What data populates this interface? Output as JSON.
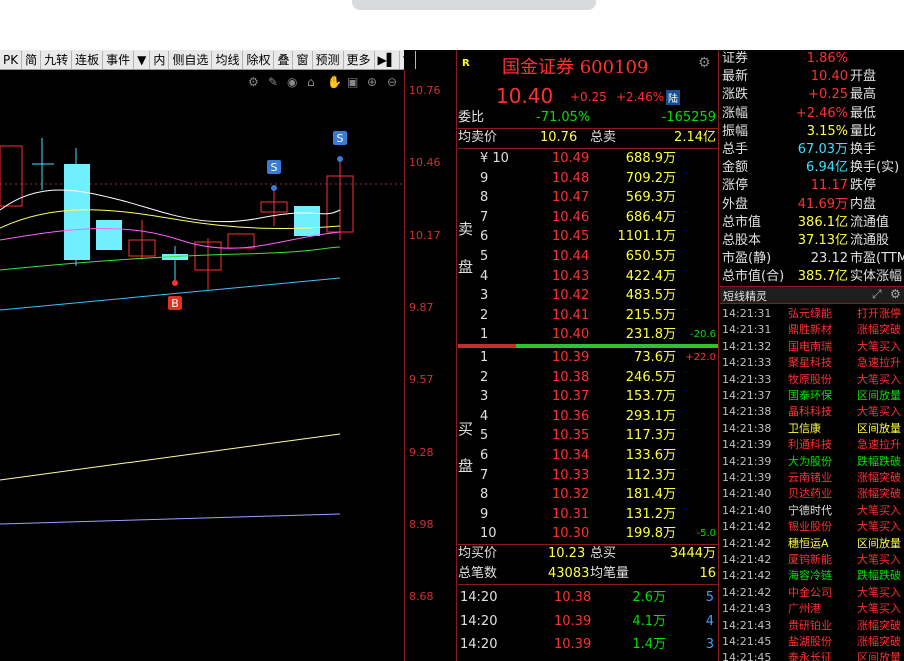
{
  "toolbar": {
    "items": [
      "PK",
      "简",
      "九转",
      "连板",
      "事件",
      "▼",
      "内",
      "侧自选",
      "均线",
      "除权",
      "叠",
      "窗",
      "预测",
      "更多",
      "▶▌",
      "▼"
    ]
  },
  "price_axis": [
    "10.76",
    "10.46",
    "10.17",
    "9.87",
    "9.57",
    "9.28",
    "8.98",
    "8.68"
  ],
  "chart_marks": {
    "s1": "S",
    "s2": "S",
    "b1": "B"
  },
  "quote": {
    "name": "国金证券 600109",
    "badge": "R",
    "price": "10.40",
    "change": "+0.25",
    "change_pct": "+2.46%",
    "board": "陆"
  },
  "summary": {
    "weibi_label": "委比",
    "weibi_pct": "-71.05%",
    "weibi_val": "-165259",
    "avg_sell_label": "均卖价",
    "avg_sell": "10.76",
    "total_sell_label": "总卖",
    "total_sell": "2.14亿",
    "avg_buy_label": "均买价",
    "avg_buy": "10.23",
    "total_buy_label": "总买",
    "total_buy": "3444万",
    "total_trades_label": "总笔数",
    "total_trades": "43083",
    "avg_vol_label": "均笔量",
    "avg_vol": "16"
  },
  "sell_side_label": [
    "卖",
    "盘"
  ],
  "buy_side_label": [
    "买",
    "盘"
  ],
  "asks": [
    {
      "lvl": "¥ 10",
      "price": "10.49",
      "vol": "688.9万",
      "chg": ""
    },
    {
      "lvl": "9",
      "price": "10.48",
      "vol": "709.2万",
      "chg": ""
    },
    {
      "lvl": "8",
      "price": "10.47",
      "vol": "569.3万",
      "chg": ""
    },
    {
      "lvl": "7",
      "price": "10.46",
      "vol": "686.4万",
      "chg": ""
    },
    {
      "lvl": "6",
      "price": "10.45",
      "vol": "1101.1万",
      "chg": ""
    },
    {
      "lvl": "5",
      "price": "10.44",
      "vol": "650.5万",
      "chg": ""
    },
    {
      "lvl": "4",
      "price": "10.43",
      "vol": "422.4万",
      "chg": ""
    },
    {
      "lvl": "3",
      "price": "10.42",
      "vol": "483.5万",
      "chg": ""
    },
    {
      "lvl": "2",
      "price": "10.41",
      "vol": "215.5万",
      "chg": ""
    },
    {
      "lvl": "1",
      "price": "10.40",
      "vol": "231.8万",
      "chg": "-20.6"
    }
  ],
  "bids": [
    {
      "lvl": "1",
      "price": "10.39",
      "vol": "73.6万",
      "chg": "+22.0"
    },
    {
      "lvl": "2",
      "price": "10.38",
      "vol": "246.5万",
      "chg": ""
    },
    {
      "lvl": "3",
      "price": "10.37",
      "vol": "153.7万",
      "chg": ""
    },
    {
      "lvl": "4",
      "price": "10.36",
      "vol": "293.1万",
      "chg": ""
    },
    {
      "lvl": "5",
      "price": "10.35",
      "vol": "117.3万",
      "chg": ""
    },
    {
      "lvl": "6",
      "price": "10.34",
      "vol": "133.6万",
      "chg": ""
    },
    {
      "lvl": "7",
      "price": "10.33",
      "vol": "112.3万",
      "chg": ""
    },
    {
      "lvl": "8",
      "price": "10.32",
      "vol": "181.4万",
      "chg": ""
    },
    {
      "lvl": "9",
      "price": "10.31",
      "vol": "131.2万",
      "chg": ""
    },
    {
      "lvl": "10",
      "price": "10.30",
      "vol": "199.8万",
      "chg": "-5.0"
    }
  ],
  "ticks": [
    {
      "time": "14:20",
      "price": "10.38",
      "vol": "2.6万",
      "n": "5"
    },
    {
      "time": "14:20",
      "price": "10.39",
      "vol": "4.1万",
      "n": "4"
    },
    {
      "time": "14:20",
      "price": "10.39",
      "vol": "1.4万",
      "n": "3"
    }
  ],
  "stats": [
    {
      "k": "证券",
      "v": "1.86%",
      "k2": "",
      "color": "#ff3030"
    },
    {
      "k": "最新",
      "v": "10.40",
      "k2": "开盘",
      "color": "#ff3030"
    },
    {
      "k": "涨跌",
      "v": "+0.25",
      "k2": "最高",
      "color": "#ff3030"
    },
    {
      "k": "涨幅",
      "v": "+2.46%",
      "k2": "最低",
      "color": "#ff3030"
    },
    {
      "k": "振幅",
      "v": "3.15%",
      "k2": "量比",
      "color": "#ffff40"
    },
    {
      "k": "总手",
      "v": "67.03万",
      "k2": "换手",
      "color": "#40e0ff"
    },
    {
      "k": "金额",
      "v": "6.94亿",
      "k2": "换手(实)",
      "color": "#40e0ff"
    },
    {
      "k": "涨停",
      "v": "11.17",
      "k2": "跌停",
      "color": "#ff3030"
    },
    {
      "k": "外盘",
      "v": "41.69万",
      "k2": "内盘",
      "color": "#ff3030"
    },
    {
      "k": "总市值",
      "v": "386.1亿",
      "k2": "流通值",
      "color": "#ffff40"
    },
    {
      "k": "总股本",
      "v": "37.13亿",
      "k2": "流通股",
      "color": "#ffff40"
    },
    {
      "k": "市盈(静)",
      "v": "23.12",
      "k2": "市盈(TTM)",
      "color": "#e0e0e0"
    },
    {
      "k": "总市值(合)",
      "v": "385.7亿",
      "k2": "实体涨幅",
      "color": "#ffff40"
    }
  ],
  "feed_title": "短线精灵",
  "feed": [
    {
      "t": "14:21:31",
      "n": "弘元绿能",
      "e": "打开涨停",
      "nc": "#ff3030",
      "ec": "#ff3030"
    },
    {
      "t": "14:21:31",
      "n": "鼎胜新材",
      "e": "涨幅突破",
      "nc": "#ff3030",
      "ec": "#ff3030"
    },
    {
      "t": "14:21:32",
      "n": "国电南瑞",
      "e": "大笔买入",
      "nc": "#ff3030",
      "ec": "#ff3030"
    },
    {
      "t": "14:21:33",
      "n": "聚星科技",
      "e": "急速拉升",
      "nc": "#ff3030",
      "ec": "#ff3030"
    },
    {
      "t": "14:21:33",
      "n": "牧原股份",
      "e": "大笔买入",
      "nc": "#ff3030",
      "ec": "#ff3030"
    },
    {
      "t": "14:21:37",
      "n": "国泰环保",
      "e": "区间放量",
      "nc": "#00e000",
      "ec": "#00e000"
    },
    {
      "t": "14:21:38",
      "n": "晶科科技",
      "e": "大笔买入",
      "nc": "#ff3030",
      "ec": "#ff3030"
    },
    {
      "t": "14:21:38",
      "n": "卫信康",
      "e": "区间放量",
      "nc": "#ffff40",
      "ec": "#ffff40"
    },
    {
      "t": "14:21:39",
      "n": "利通科技",
      "e": "急速拉升",
      "nc": "#ff3030",
      "ec": "#ff3030"
    },
    {
      "t": "14:21:39",
      "n": "大为股份",
      "e": "跌幅跌破",
      "nc": "#00e000",
      "ec": "#00e000"
    },
    {
      "t": "14:21:39",
      "n": "云南锗业",
      "e": "涨幅突破",
      "nc": "#ff3030",
      "ec": "#ff3030"
    },
    {
      "t": "14:21:40",
      "n": "贝达药业",
      "e": "涨幅突破",
      "nc": "#ff3030",
      "ec": "#ff3030"
    },
    {
      "t": "14:21:40",
      "n": "宁德时代",
      "e": "大笔买入",
      "nc": "#e0e0e0",
      "ec": "#ff3030"
    },
    {
      "t": "14:21:42",
      "n": "锡业股份",
      "e": "大笔买入",
      "nc": "#ff3030",
      "ec": "#ff3030"
    },
    {
      "t": "14:21:42",
      "n": "穗恒运A",
      "e": "区间放量",
      "nc": "#ffff40",
      "ec": "#ffff40"
    },
    {
      "t": "14:21:42",
      "n": "厦钨新能",
      "e": "大笔买入",
      "nc": "#ff3030",
      "ec": "#ff3030"
    },
    {
      "t": "14:21:42",
      "n": "海容冷链",
      "e": "跌幅跌破",
      "nc": "#00e000",
      "ec": "#00e000"
    },
    {
      "t": "14:21:42",
      "n": "中金公司",
      "e": "大笔买入",
      "nc": "#ff3030",
      "ec": "#ff3030"
    },
    {
      "t": "14:21:43",
      "n": "广州港",
      "e": "大笔买入",
      "nc": "#ff3030",
      "ec": "#ff3030"
    },
    {
      "t": "14:21:43",
      "n": "贵研铂业",
      "e": "涨幅突破",
      "nc": "#ff3030",
      "ec": "#ff3030"
    },
    {
      "t": "14:21:45",
      "n": "盐湖股份",
      "e": "涨幅突破",
      "nc": "#ff3030",
      "ec": "#ff3030"
    },
    {
      "t": "14:21:45",
      "n": "泰永长征",
      "e": "区间放量",
      "nc": "#ff3030",
      "ec": "#ff3030"
    }
  ]
}
